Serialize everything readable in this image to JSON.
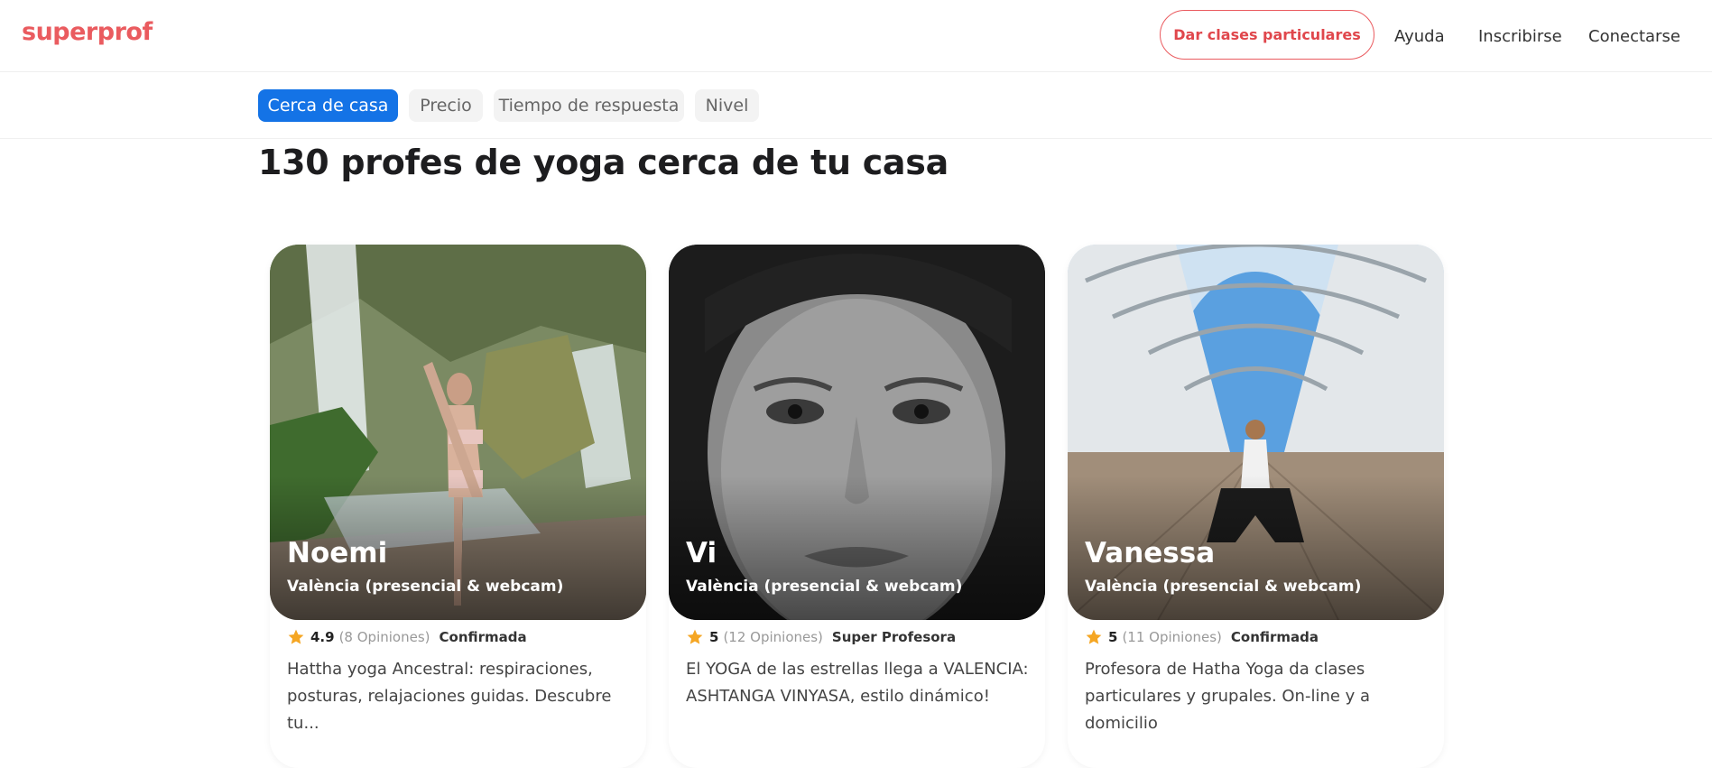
{
  "header": {
    "logo": "superprof",
    "teach_button": "Dar clases particulares",
    "nav": {
      "ayuda": "Ayuda",
      "inscribirse": "Inscribirse",
      "conectarse": "Conectarse"
    }
  },
  "filters": [
    "Cerca de casa",
    "Precio",
    "Tiempo de respuesta",
    "Nivel"
  ],
  "page_title": "130 profes de yoga cerca de tu casa",
  "cards": [
    {
      "name": "Noemi",
      "location": "València (presencial & webcam)",
      "rating": "4.9",
      "reviews": "(8 Opiniones)",
      "badge": "Confirmada",
      "description": "Hattha yoga Ancestral: respiraciones, posturas, relajaciones guidas. Descubre tu..."
    },
    {
      "name": "Vi",
      "location": "València (presencial & webcam)",
      "rating": "5",
      "reviews": "(12 Opiniones)",
      "badge": "Super Profesora",
      "description": "El YOGA de las estrellas llega a VALENCIA: ASHTANGA VINYASA, estilo dinámico!"
    },
    {
      "name": "Vanessa",
      "location": "València (presencial & webcam)",
      "rating": "5",
      "reviews": "(11 Opiniones)",
      "badge": "Confirmada",
      "description": "Profesora de Hatha Yoga da clases particulares y grupales. On-line y a domicilio"
    }
  ],
  "colors": {
    "brand": "#ea5b5f",
    "active_chip": "#1473e6",
    "star": "#f5a623"
  }
}
